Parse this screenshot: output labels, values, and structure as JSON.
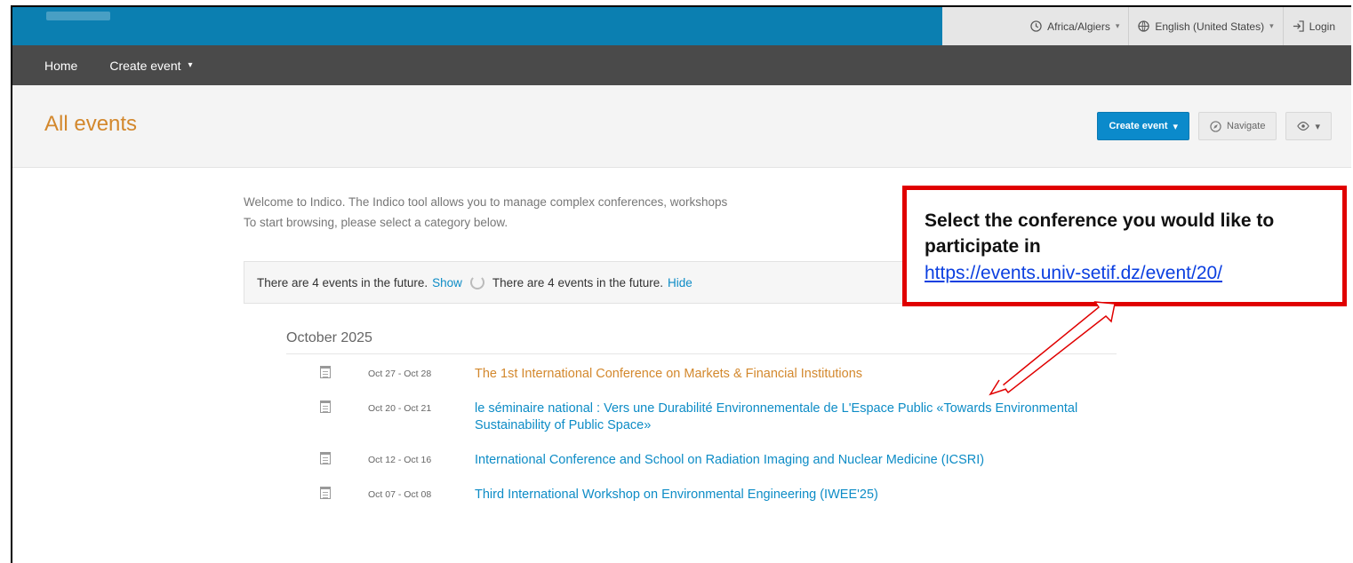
{
  "topbar": {
    "timezone": "Africa/Algiers",
    "language": "English (United States)",
    "login": "Login"
  },
  "nav": {
    "home": "Home",
    "create_event": "Create event"
  },
  "header": {
    "title": "All events",
    "create_event_btn": "Create event",
    "navigate_btn": "Navigate"
  },
  "welcome": {
    "line1": "Welcome to Indico. The Indico tool allows you to manage complex conferences, workshops",
    "line2": "To start browsing, please select a category below."
  },
  "future": {
    "text1": "There are 4 events in the future.",
    "show": "Show",
    "text2": "There are 4 events in the future.",
    "hide": "Hide"
  },
  "month": "October 2025",
  "events": [
    {
      "dates": "Oct 27 - Oct 28",
      "title": "The 1st International Conference on Markets & Financial Institutions"
    },
    {
      "dates": "Oct 20 - Oct 21",
      "title": "le séminaire national : Vers une Durabilité Environnementale de L'Espace Public «Towards Environmental Sustainability of Public Space»"
    },
    {
      "dates": "Oct 12 - Oct 16",
      "title": "International Conference and School on Radiation Imaging and Nuclear Medicine (ICSRI)"
    },
    {
      "dates": "Oct 07 - Oct 08",
      "title": "Third International Workshop on Environmental Engineering (IWEE'25)"
    }
  ],
  "callout": {
    "text": "Select the conference you would like to participate in",
    "link": "https://events.univ-setif.dz/event/20/"
  },
  "colors": {
    "topbar": "#0b7fb1",
    "navbar": "#4a4a4a",
    "title": "#d3882d",
    "link": "#0d8cc6",
    "callout_border": "#e00000"
  }
}
